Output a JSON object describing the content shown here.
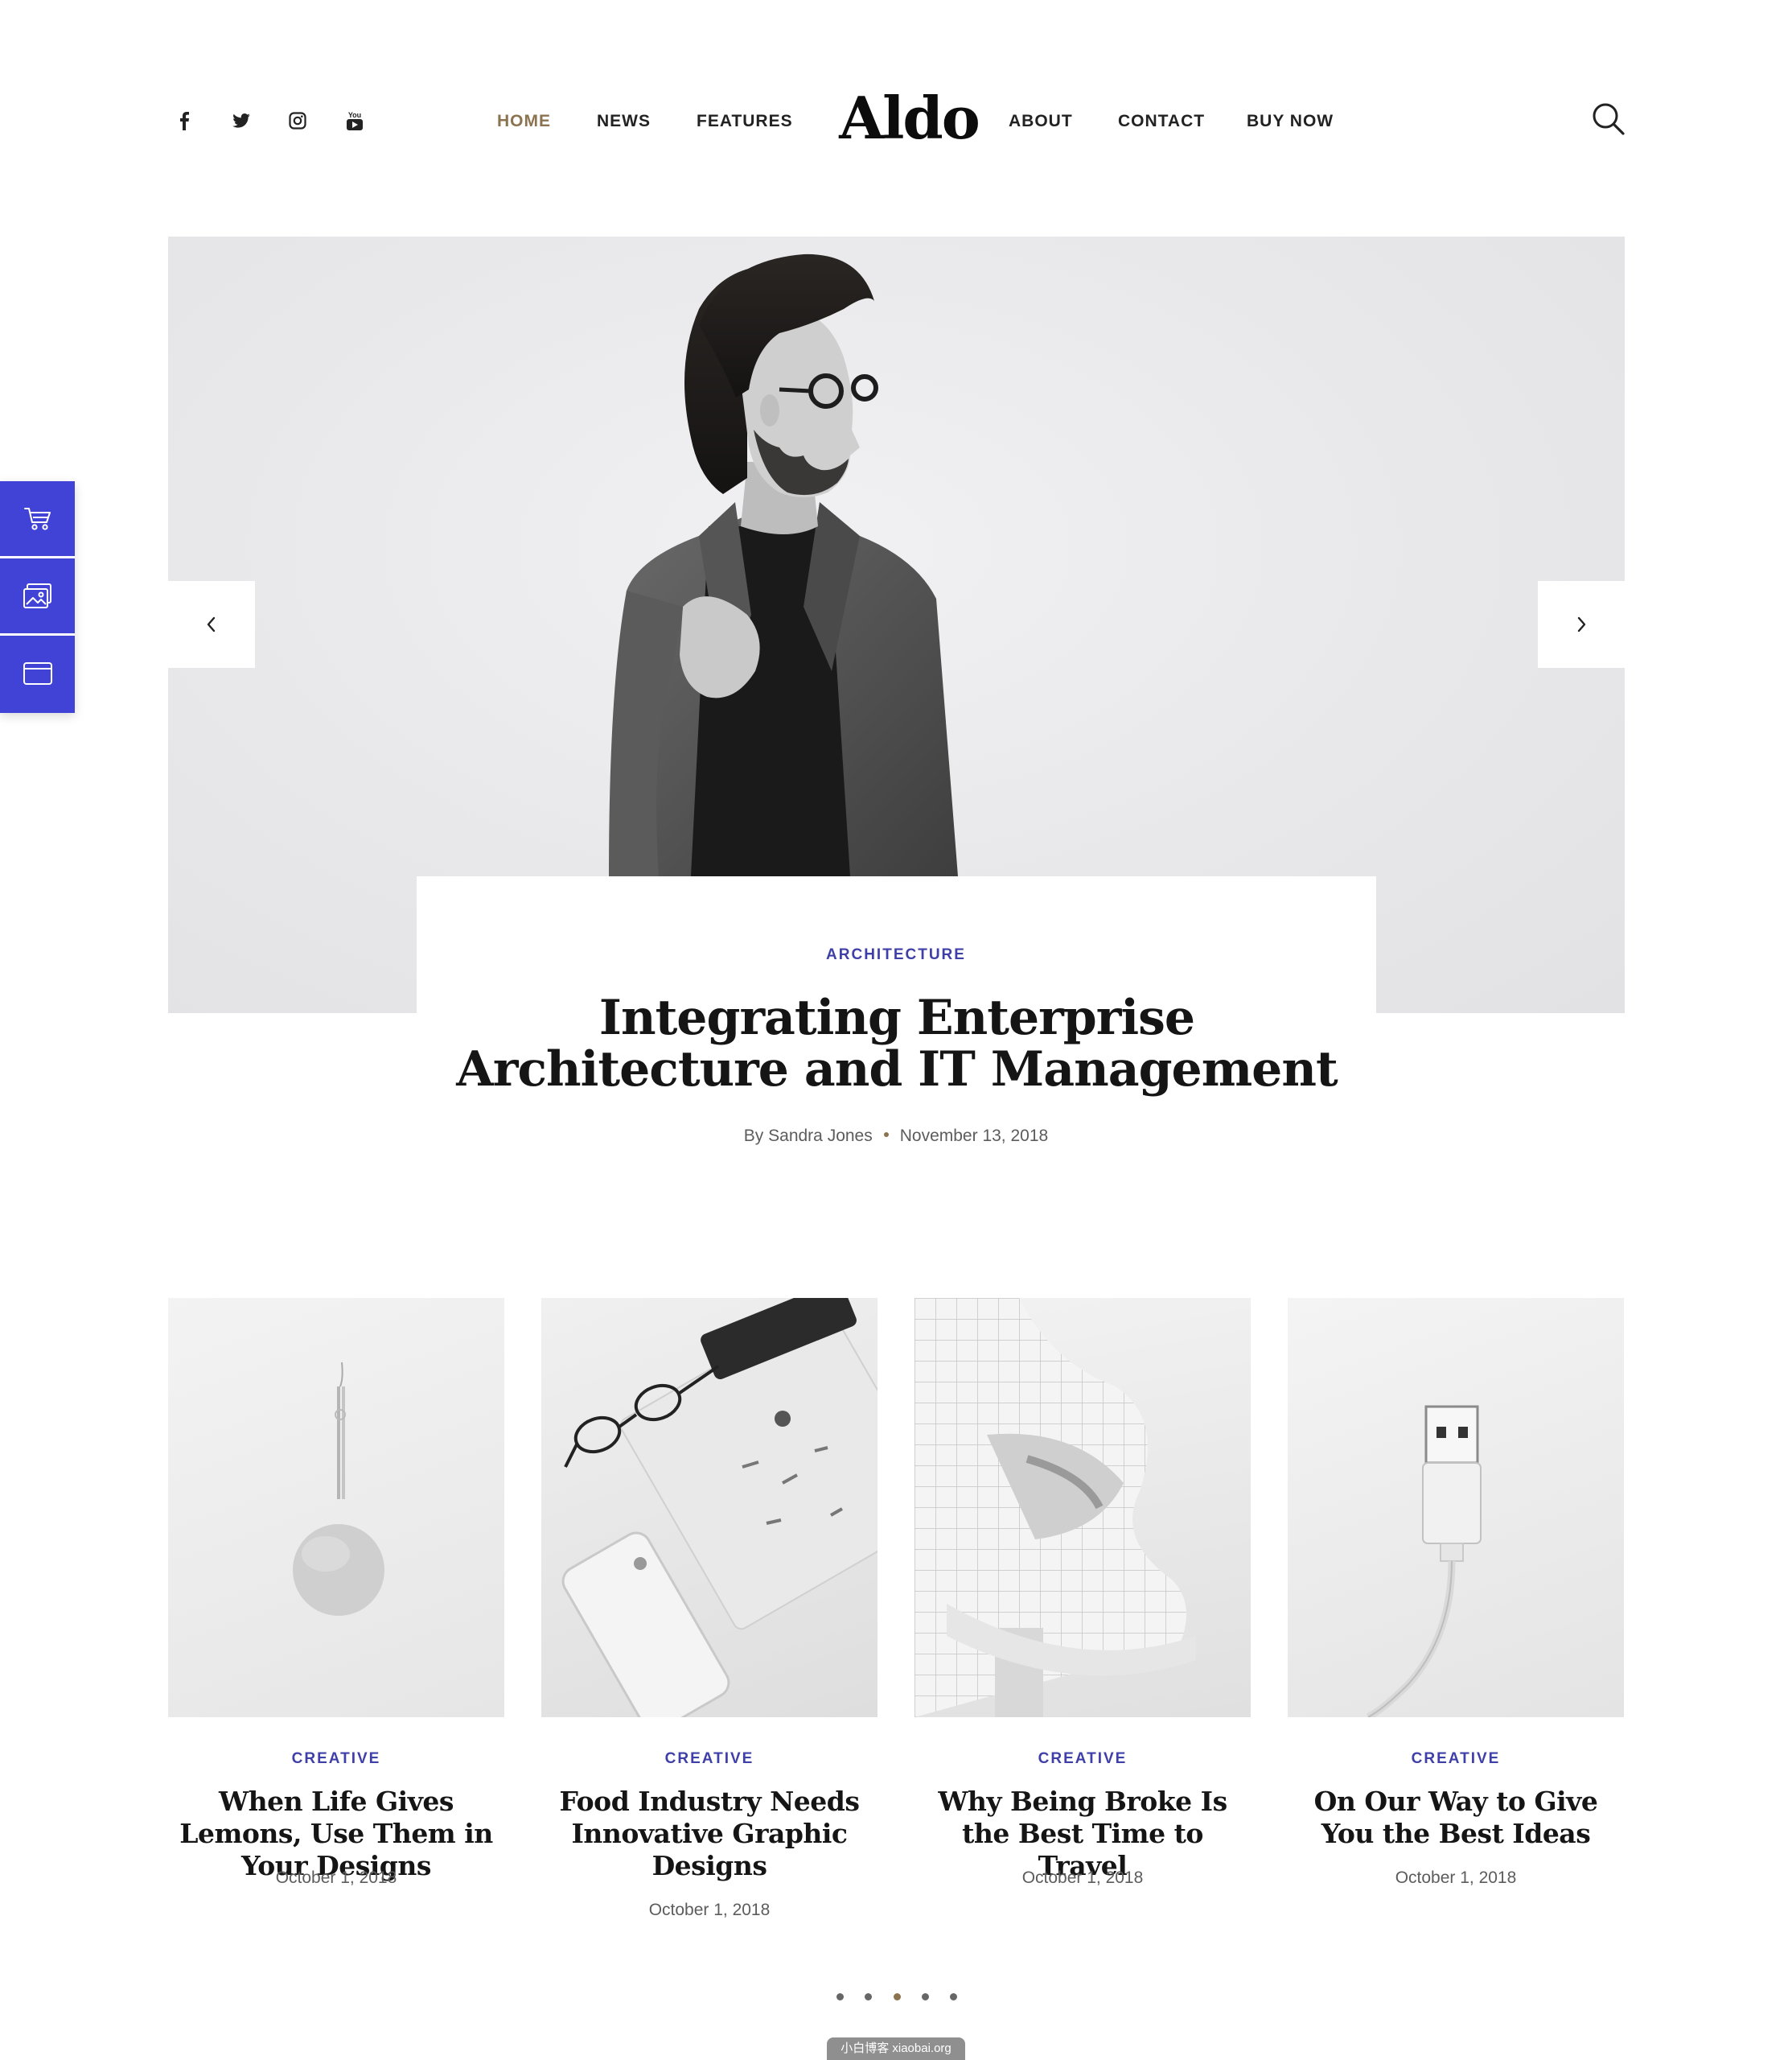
{
  "header": {
    "social": [
      {
        "name": "facebook-icon"
      },
      {
        "name": "twitter-icon"
      },
      {
        "name": "instagram-icon"
      },
      {
        "name": "youtube-icon",
        "label": "You"
      }
    ],
    "nav_left": [
      "HOME",
      "NEWS",
      "FEATURES"
    ],
    "logo": "Aldo",
    "nav_right": [
      "ABOUT",
      "CONTACT",
      "BUY NOW"
    ],
    "active_nav": "HOME",
    "search_icon": "search-icon"
  },
  "dock": {
    "items": [
      "cart-icon",
      "gallery-icon",
      "browser-window-icon"
    ],
    "color": "#4142d6"
  },
  "hero": {
    "category": "ARCHITECTURE",
    "title": "Integrating Enterprise Architecture and IT Management",
    "author": "By Sandra Jones",
    "date": "November 13, 2018",
    "prev_icon": "chevron-left-icon",
    "next_icon": "chevron-right-icon"
  },
  "posts": [
    {
      "category": "CREATIVE",
      "title": "When Life Gives Lemons, Use Them in Your Designs",
      "date": "October 1, 2018"
    },
    {
      "category": "CREATIVE",
      "title": "Food Industry Needs Innovative Graphic Designs",
      "date": "October 1, 2018"
    },
    {
      "category": "CREATIVE",
      "title": "Why Being Broke Is the Best Time to Travel",
      "date": "October 1, 2018"
    },
    {
      "category": "CREATIVE",
      "title": "On Our Way to Give You the Best Ideas",
      "date": "October 1, 2018"
    }
  ],
  "pagination": {
    "count": 5,
    "active": 3
  },
  "colors": {
    "accent": "#3f3fa8",
    "gold": "#8b7350",
    "text": "#151515"
  },
  "watermark": "小白博客 xiaobai.org"
}
